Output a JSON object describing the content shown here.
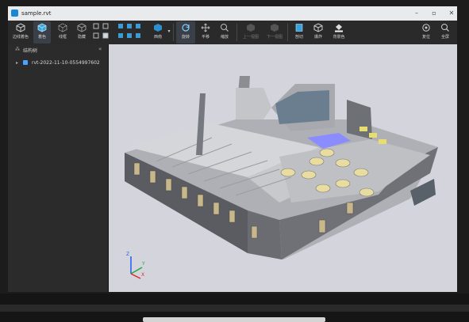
{
  "window": {
    "title": "sample.rvt"
  },
  "toolbar": {
    "edge_color": "边线着色",
    "color": "着色",
    "wireframe": "线框",
    "hidden": "隐藏",
    "projection": "西南",
    "rotate": "旋转",
    "pan": "平移",
    "zoom": "缩放",
    "prev_view": "上一视图",
    "next_view": "下一视图",
    "section": "剖切",
    "tools": "爆炸",
    "background": "背景色",
    "reset": "复位",
    "fullscreen": "全屏"
  },
  "panel": {
    "title": "结构树",
    "collapse": "«",
    "tree_item": "rvt-2022-11-10-0554997602"
  },
  "axes": {
    "x": "X",
    "y": "Y",
    "z": "Z"
  },
  "colors": {
    "accent": "#1a87d4",
    "panel": "#2b2b2c",
    "viewport": "#d4d5dc"
  }
}
